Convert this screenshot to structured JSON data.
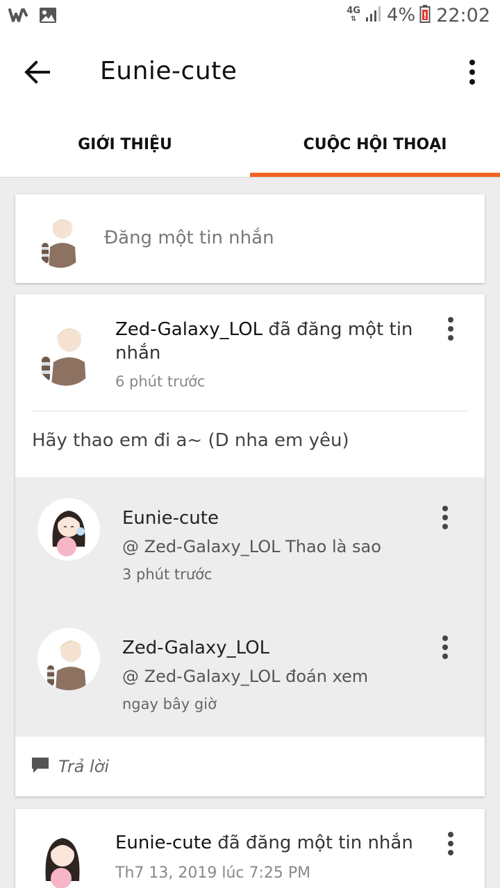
{
  "status_bar": {
    "network": "4G",
    "battery": "4%",
    "time": "22:02",
    "left_icons": [
      "wattpad-icon",
      "image-icon"
    ]
  },
  "app_bar": {
    "title": "Eunie-cute"
  },
  "tabs": [
    {
      "label": "GIỚI THIỆU",
      "active": false
    },
    {
      "label": "CUỘC HỘI THOẠI",
      "active": true
    }
  ],
  "accent_color": "#f26522",
  "compose": {
    "placeholder": "Đăng một tin nhắn"
  },
  "post": {
    "author": "Zed-Galaxy_LOL",
    "action": " đã đăng một tin nhắn",
    "time": "6 phút trước",
    "body": "Hãy thao em đi a~ (D nha em yêu)",
    "replies": [
      {
        "author": "Eunie-cute",
        "text": "@ Zed-Galaxy_LOL  Thao là sao",
        "time": "3 phút trước"
      },
      {
        "author": "Zed-Galaxy_LOL",
        "text": "@ Zed-Galaxy_LOL  đoán xem",
        "time": "ngay bây giờ"
      }
    ],
    "reply_label": "Trả lời"
  },
  "post2": {
    "author": "Eunie-cute",
    "action": " đã đăng một tin nhắn",
    "time": "Th7 13, 2019 lúc 7:25 PM"
  }
}
